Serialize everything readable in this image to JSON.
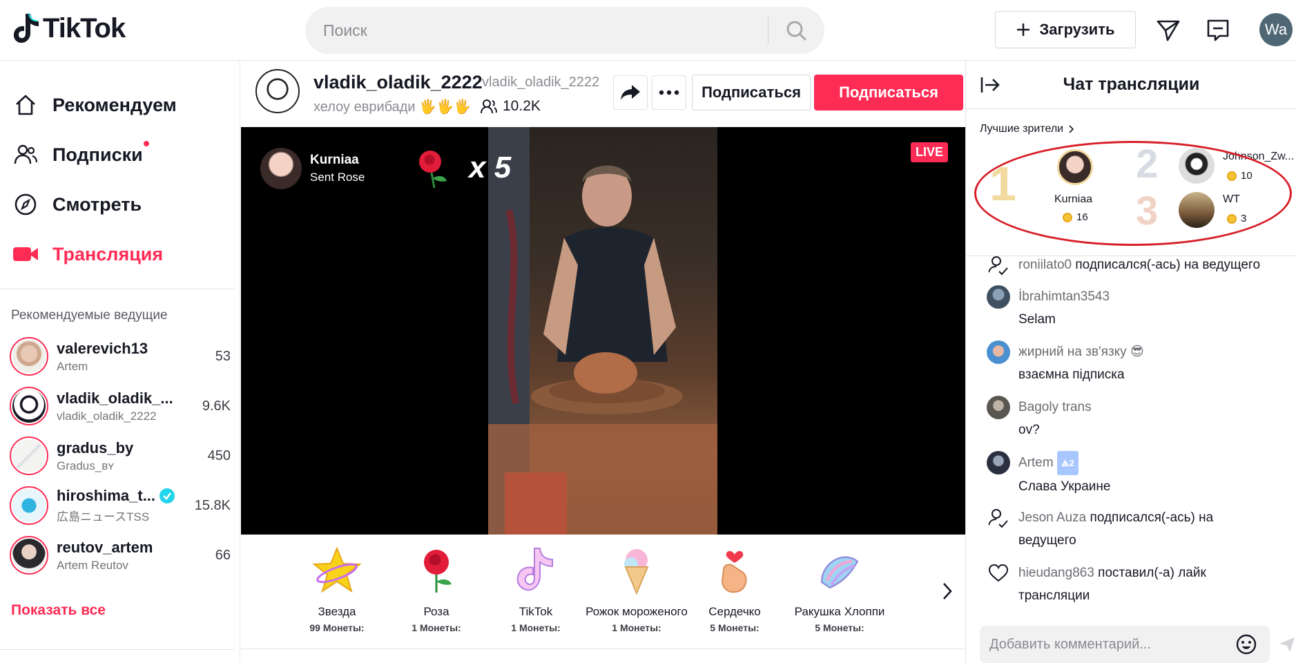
{
  "header": {
    "logo_text": "TikTok",
    "search_placeholder": "Поиск",
    "upload_label": "Загрузить",
    "user_initials": "Wa"
  },
  "sidebar": {
    "nav": [
      {
        "label": "Рекомендуем",
        "icon": "home-icon"
      },
      {
        "label": "Подписки",
        "icon": "following-icon"
      },
      {
        "label": "Смотреть",
        "icon": "compass-icon"
      },
      {
        "label": "Трансляция",
        "icon": "live-camera-icon"
      }
    ],
    "recommended_title": "Рекомендуемые ведущие",
    "hosts": [
      {
        "name": "valerevich13",
        "sub": "Artem",
        "count": "53"
      },
      {
        "name": "vladik_oladik_...",
        "sub": "vladik_oladik_2222",
        "count": "9.6K"
      },
      {
        "name": "gradus_by",
        "sub": "Gradus_ʙʏ",
        "count": "450"
      },
      {
        "name": "hiroshima_t...",
        "sub": "広島ニュースTSS",
        "count": "15.8K",
        "verified": true
      },
      {
        "name": "reutov_artem",
        "sub": "Artem Reutov",
        "count": "66"
      }
    ],
    "show_all": "Показать все"
  },
  "streamer": {
    "name": "vladik_oladik_2222",
    "handle": "vladik_oladik_2222",
    "bio": "хелоу еврибади 🖐🖐🖐",
    "viewers": "10.2K",
    "follow_outline": "Подписаться",
    "follow_primary": "Подписаться"
  },
  "video": {
    "gift_sender": "Kurniaa",
    "gift_action": "Sent Rose",
    "gift_multiplier": "x 5",
    "live_label": "LIVE"
  },
  "gifts": [
    {
      "name": "Звезда",
      "price": "99 Монеты:",
      "icon": "star-icon"
    },
    {
      "name": "Роза",
      "price": "1 Монеты:",
      "icon": "rose-icon"
    },
    {
      "name": "TikTok",
      "price": "1 Монеты:",
      "icon": "tiktok-icon"
    },
    {
      "name": "Рожок мороженого",
      "price": "1 Монеты:",
      "icon": "ice-cream-icon"
    },
    {
      "name": "Сердечко",
      "price": "5 Монеты:",
      "icon": "finger-heart-icon"
    },
    {
      "name": "Ракушка Хлоппи",
      "price": "5 Монеты:",
      "icon": "shell-icon"
    }
  ],
  "chat": {
    "title": "Чат трансляции",
    "top_viewers_label": "Лучшие зрители",
    "top_viewers": [
      {
        "rank": "1",
        "name": "Kurniaa",
        "coins": "16"
      },
      {
        "rank": "2",
        "name": "Johnson_Zw...",
        "coins": "10"
      },
      {
        "rank": "3",
        "name": "WT",
        "coins": "3"
      }
    ],
    "messages": [
      {
        "user": "roniilato0",
        "text": "подписался(-ась) на ведущего",
        "kind": "follow"
      },
      {
        "user": "İbrahimtan3543",
        "text": "Selam",
        "kind": "comment"
      },
      {
        "user": "жирний на зв'язку 😎",
        "text": "взаємна підписка",
        "kind": "comment"
      },
      {
        "user": "Bagoly trans",
        "text": "ov?",
        "kind": "comment"
      },
      {
        "user": "Artem",
        "badge": "⟁2",
        "text": "Слава Украине",
        "kind": "comment"
      },
      {
        "user": "Jeson Auza",
        "text": "подписался(-ась) на",
        "text2": "ведущего",
        "kind": "follow"
      },
      {
        "user": "hieudang863",
        "text": "поставил(-а) лайк",
        "text2": "трансляции",
        "kind": "like"
      }
    ],
    "input_placeholder": "Добавить комментарий..."
  }
}
